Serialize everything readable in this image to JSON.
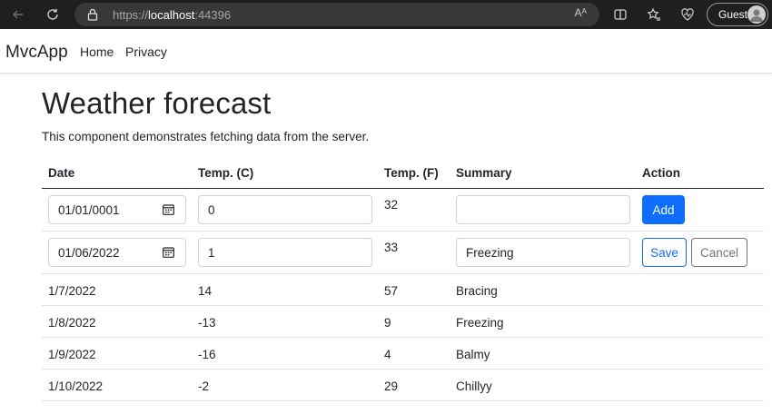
{
  "browser": {
    "url_protocol": "https://",
    "url_host": "localhost",
    "url_port": ":44396",
    "read_aloud_label": "Aᴬ",
    "profile_label": "Guest"
  },
  "navbar": {
    "brand": "MvcApp",
    "links": [
      "Home",
      "Privacy"
    ]
  },
  "page": {
    "title": "Weather forecast",
    "description": "This component demonstrates fetching data from the server."
  },
  "table": {
    "headers": [
      "Date",
      "Temp. (C)",
      "Temp. (F)",
      "Summary",
      "Action"
    ],
    "new_row": {
      "date": "01/01/0001",
      "temp_c": "0",
      "temp_f": "32",
      "summary": "",
      "add_label": "Add"
    },
    "edit_row": {
      "date": "01/06/2022",
      "temp_c": "1",
      "temp_f": "33",
      "summary": "Freezing",
      "save_label": "Save",
      "cancel_label": "Cancel"
    },
    "rows": [
      {
        "date": "1/7/2022",
        "temp_c": "14",
        "temp_f": "57",
        "summary": "Bracing"
      },
      {
        "date": "1/8/2022",
        "temp_c": "-13",
        "temp_f": "9",
        "summary": "Freezing"
      },
      {
        "date": "1/9/2022",
        "temp_c": "-16",
        "temp_f": "4",
        "summary": "Balmy"
      },
      {
        "date": "1/10/2022",
        "temp_c": "-2",
        "temp_f": "29",
        "summary": "Chillyy"
      }
    ]
  },
  "colors": {
    "primary": "#0d6efd",
    "secondary": "#6c757d",
    "chrome_bg": "#1f1f1f"
  }
}
